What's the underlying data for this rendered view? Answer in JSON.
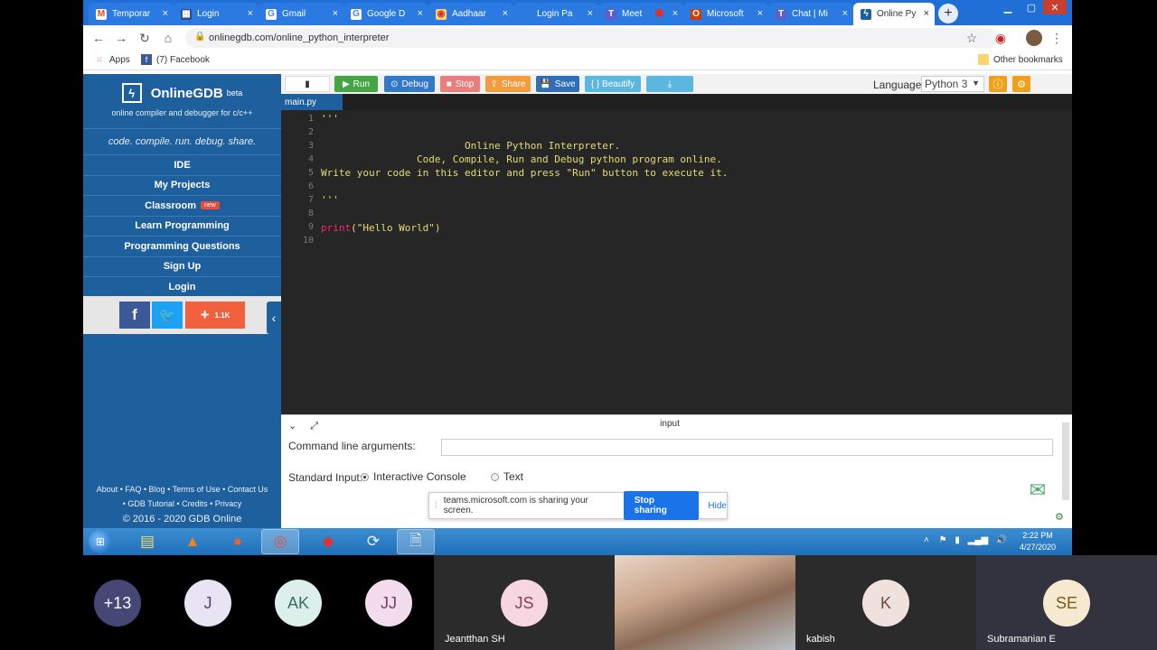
{
  "browser": {
    "tabs": [
      {
        "title": "Temporar",
        "icon": "gmail-icon"
      },
      {
        "title": "Login",
        "icon": "grid-icon"
      },
      {
        "title": "Gmail",
        "icon": "google-icon"
      },
      {
        "title": "Google D",
        "icon": "google-icon"
      },
      {
        "title": "Aadhaar",
        "icon": "aadhaar-icon"
      },
      {
        "title": "Login Pa",
        "icon": "blank-icon"
      },
      {
        "title": "Meet",
        "icon": "teams-icon"
      },
      {
        "title": "Microsoft",
        "icon": "office-icon"
      },
      {
        "title": "Chat | Mi",
        "icon": "teams-icon"
      },
      {
        "title": "Online Py",
        "icon": "onlinegdb-icon"
      }
    ],
    "new_tab": "+",
    "url": "onlinegdb.com/online_python_interpreter",
    "bookmarks": {
      "apps": "Apps",
      "facebook": "(7) Facebook",
      "other": "Other bookmarks"
    }
  },
  "sidebar": {
    "brand": "OnlineGDB",
    "brand_sup": "beta",
    "tagline": "online compiler and debugger for c/c++",
    "slogan": "code. compile. run. debug. share.",
    "menu": [
      "IDE",
      "My Projects",
      "Classroom",
      "Learn Programming",
      "Programming Questions",
      "Sign Up",
      "Login"
    ],
    "classroom_badge": "new",
    "share_count": "1.1K",
    "footer_line1": "About • FAQ • Blog • Terms of Use • Contact Us",
    "footer_line2": "• GDB Tutorial • Credits • Privacy",
    "copyright": "© 2016 - 2020 GDB Online"
  },
  "editor": {
    "toolbar": {
      "run": "Run",
      "debug": "Debug",
      "stop": "Stop",
      "share": "Share",
      "save": "Save",
      "beautify": "{ } Beautify"
    },
    "language_label": "Language",
    "language_value": "Python 3",
    "file_tab": "main.py",
    "line_numbers": [
      "1",
      "2",
      "3",
      "4",
      "5",
      "6",
      "7",
      "8",
      "9",
      "10"
    ],
    "lines": [
      "'''",
      "",
      "                        Online Python Interpreter.",
      "                Code, Compile, Run and Debug python program online.",
      "Write your code in this editor and press \"Run\" button to execute it.",
      "",
      "'''",
      "",
      "",
      ""
    ],
    "print_fn": "print",
    "print_arg": "(\"Hello World\")"
  },
  "input_panel": {
    "title": "input",
    "cla_label": "Command line arguments:",
    "cla_value": "",
    "stdin_label": "Standard Input:",
    "option_console": "Interactive Console",
    "option_text": "Text",
    "selected": "Interactive Console"
  },
  "share_banner": {
    "message": "teams.microsoft.com is sharing your screen.",
    "stop": "Stop sharing",
    "hide": "Hide"
  },
  "taskbar": {
    "time": "2:22 PM",
    "date": "4/27/2020"
  },
  "participants": [
    {
      "initials": "+13",
      "name": "",
      "bg": "#464775",
      "fg": "#ffffff"
    },
    {
      "initials": "J",
      "name": "",
      "bg": "#e8e4f3",
      "fg": "#464775"
    },
    {
      "initials": "AK",
      "name": "",
      "bg": "#dcefea",
      "fg": "#3b6e5e"
    },
    {
      "initials": "JJ",
      "name": "",
      "bg": "#f3dceb",
      "fg": "#7a3b62"
    },
    {
      "initials": "JS",
      "name": "Jeantthan SH",
      "bg": "#f6d6e0",
      "fg": "#8a3b56"
    },
    {
      "initials": "",
      "name": "",
      "bg": "#c9a68d",
      "fg": "#ffffff"
    },
    {
      "initials": "K",
      "name": "kabish",
      "bg": "#efe2dc",
      "fg": "#6a4b3e"
    },
    {
      "initials": "SE",
      "name": "Subramanian E",
      "bg": "#f5ead0",
      "fg": "#7a5b1e"
    }
  ],
  "colors": {
    "site_blue": "#1e5f9e",
    "run_green": "#45a545",
    "debug_blue": "#3478c9",
    "stop_red": "#e96a6a",
    "share_orange": "#f39c3d",
    "save_blue": "#2f6fba",
    "beautify_teal": "#5bb6e0"
  }
}
